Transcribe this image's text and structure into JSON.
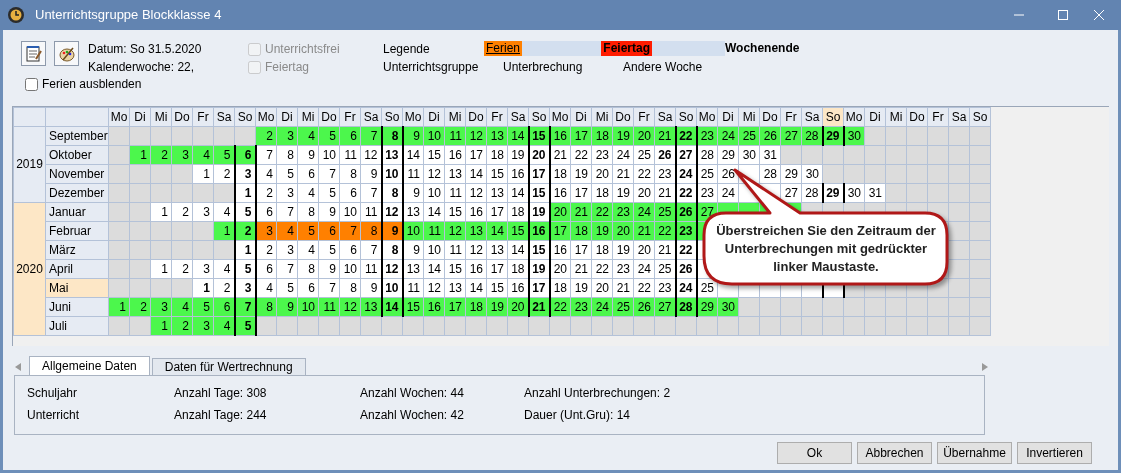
{
  "window": {
    "title": "Unterrichtsgruppe Blockklasse 4"
  },
  "toolbar": {
    "date": "Datum: So 31.5.2020",
    "calendar_week": "Kalenderwoche: 22,",
    "checkboxes": [
      {
        "label": "Unterrichtsfrei",
        "checked": false,
        "disabled": true
      },
      {
        "label": "Feiertag",
        "checked": false,
        "disabled": true
      }
    ],
    "legend": {
      "title": "Legende",
      "items": [
        {
          "label": "Ferien",
          "kind": "ferien"
        },
        {
          "label": "Feiertag",
          "kind": "feiertag"
        },
        {
          "label": "Wochenende",
          "kind": "weekend"
        },
        {
          "label": "Unterrichtsgruppe",
          "kind": "plain"
        },
        {
          "label": "Unterbrechung",
          "kind": "plain"
        },
        {
          "label": "Andere Woche",
          "kind": "plain"
        }
      ]
    },
    "hide_holidays": {
      "label": "Ferien ausblenden",
      "checked": false
    }
  },
  "calendar": {
    "weekdays": [
      {
        "label": "Mo",
        "selected": false
      },
      {
        "label": "Di",
        "selected": false
      },
      {
        "label": "Mi",
        "selected": false
      },
      {
        "label": "Do",
        "selected": false
      },
      {
        "label": "Fr",
        "selected": false
      },
      {
        "label": "Sa",
        "selected": false
      },
      {
        "label": "So",
        "selected": false
      },
      {
        "label": "Mo",
        "selected": false
      },
      {
        "label": "Di",
        "selected": false
      },
      {
        "label": "Mi",
        "selected": false
      },
      {
        "label": "Do",
        "selected": false
      },
      {
        "label": "Fr",
        "selected": false
      },
      {
        "label": "Sa",
        "selected": false
      },
      {
        "label": "So",
        "selected": false
      },
      {
        "label": "Mo",
        "selected": false
      },
      {
        "label": "Di",
        "selected": false
      },
      {
        "label": "Mi",
        "selected": false
      },
      {
        "label": "Do",
        "selected": false
      },
      {
        "label": "Fr",
        "selected": false
      },
      {
        "label": "Sa",
        "selected": false
      },
      {
        "label": "So",
        "selected": false
      },
      {
        "label": "Mo",
        "selected": false
      },
      {
        "label": "Di",
        "selected": false
      },
      {
        "label": "Mi",
        "selected": false
      },
      {
        "label": "Do",
        "selected": false
      },
      {
        "label": "Fr",
        "selected": false
      },
      {
        "label": "Sa",
        "selected": false
      },
      {
        "label": "So",
        "selected": false
      },
      {
        "label": "Mo",
        "selected": false
      },
      {
        "label": "Di",
        "selected": false
      },
      {
        "label": "Mi",
        "selected": false
      },
      {
        "label": "Do",
        "selected": false
      },
      {
        "label": "Fr",
        "selected": false
      },
      {
        "label": "Sa",
        "selected": false
      },
      {
        "label": "So",
        "selected": true
      },
      {
        "label": "Mo",
        "selected": false
      },
      {
        "label": "Di",
        "selected": false
      },
      {
        "label": "Mi",
        "selected": false
      },
      {
        "label": "Do",
        "selected": false
      },
      {
        "label": "Fr",
        "selected": false
      },
      {
        "label": "Sa",
        "selected": false
      },
      {
        "label": "So",
        "selected": false
      }
    ],
    "years": [
      {
        "year": "2019",
        "selected": false,
        "months": [
          {
            "name": "September",
            "selected": false,
            "days": [
              {
                "kind": "blank"
              },
              {
                "kind": "blank"
              },
              {
                "kind": "blank"
              },
              {
                "kind": "blank"
              },
              {
                "kind": "blank"
              },
              {
                "kind": "blank"
              },
              {
                "kind": "blank"
              },
              {
                "day": "2",
                "kind": "lesson"
              },
              {
                "day": "3",
                "kind": "lesson"
              },
              {
                "day": "4",
                "kind": "lesson"
              },
              {
                "day": "5",
                "kind": "lesson"
              },
              {
                "day": "6",
                "kind": "lesson"
              },
              {
                "day": "7",
                "kind": "lesson"
              },
              {
                "day": "8",
                "kind": "lesson"
              },
              {
                "day": "9",
                "kind": "lesson"
              },
              {
                "day": "10",
                "kind": "lesson"
              },
              {
                "day": "11",
                "kind": "lesson"
              },
              {
                "day": "12",
                "kind": "lesson"
              },
              {
                "day": "13",
                "kind": "lesson"
              },
              {
                "day": "14",
                "kind": "lesson"
              },
              {
                "day": "15",
                "kind": "lesson"
              },
              {
                "day": "16",
                "kind": "lesson"
              },
              {
                "day": "17",
                "kind": "lesson"
              },
              {
                "day": "18",
                "kind": "lesson"
              },
              {
                "day": "19",
                "kind": "lesson"
              },
              {
                "day": "20",
                "kind": "lesson"
              },
              {
                "day": "21",
                "kind": "lesson"
              },
              {
                "day": "22",
                "kind": "lesson"
              },
              {
                "day": "23",
                "kind": "lesson"
              },
              {
                "day": "24",
                "kind": "lesson"
              },
              {
                "day": "25",
                "kind": "lesson"
              },
              {
                "day": "26",
                "kind": "lesson"
              },
              {
                "day": "27",
                "kind": "lesson"
              },
              {
                "day": "28",
                "kind": "lesson"
              },
              {
                "day": "29",
                "kind": "lesson"
              },
              {
                "day": "30",
                "kind": "lesson"
              }
            ]
          },
          {
            "name": "Oktober",
            "selected": false,
            "days": [
              {
                "kind": "blank"
              },
              {
                "day": "1",
                "kind": "lesson"
              },
              {
                "day": "2",
                "kind": "lesson"
              },
              {
                "day": "3",
                "kind": "lesson"
              },
              {
                "day": "4",
                "kind": "lesson"
              },
              {
                "day": "5",
                "kind": "lesson"
              },
              {
                "day": "6",
                "kind": "lesson"
              },
              {
                "day": "7",
                "kind": "other"
              },
              {
                "day": "8",
                "kind": "other"
              },
              {
                "day": "9",
                "kind": "other"
              },
              {
                "day": "10",
                "kind": "other"
              },
              {
                "day": "11",
                "kind": "other"
              },
              {
                "day": "12",
                "kind": "other"
              },
              {
                "day": "13",
                "kind": "other"
              },
              {
                "day": "14",
                "kind": "other"
              },
              {
                "day": "15",
                "kind": "other"
              },
              {
                "day": "16",
                "kind": "other"
              },
              {
                "day": "17",
                "kind": "other"
              },
              {
                "day": "18",
                "kind": "other"
              },
              {
                "day": "19",
                "kind": "other"
              },
              {
                "day": "20",
                "kind": "other"
              },
              {
                "day": "21",
                "kind": "other"
              },
              {
                "day": "22",
                "kind": "other"
              },
              {
                "day": "23",
                "kind": "other"
              },
              {
                "day": "24",
                "kind": "other"
              },
              {
                "day": "25",
                "kind": "other"
              },
              {
                "day": "26",
                "kind": "other",
                "bold": true
              },
              {
                "day": "27",
                "kind": "other"
              },
              {
                "day": "28",
                "kind": "other"
              },
              {
                "day": "29",
                "kind": "other"
              },
              {
                "day": "30",
                "kind": "other"
              },
              {
                "day": "31",
                "kind": "other"
              }
            ]
          },
          {
            "name": "November",
            "selected": false,
            "days": [
              {
                "kind": "blank"
              },
              {
                "kind": "blank"
              },
              {
                "kind": "blank"
              },
              {
                "kind": "blank"
              },
              {
                "day": "1",
                "kind": "other"
              },
              {
                "day": "2",
                "kind": "other"
              },
              {
                "day": "3",
                "kind": "other"
              },
              {
                "day": "4",
                "kind": "other"
              },
              {
                "day": "5",
                "kind": "other"
              },
              {
                "day": "6",
                "kind": "other"
              },
              {
                "day": "7",
                "kind": "other"
              },
              {
                "day": "8",
                "kind": "other"
              },
              {
                "day": "9",
                "kind": "other"
              },
              {
                "day": "10",
                "kind": "other"
              },
              {
                "day": "11",
                "kind": "other"
              },
              {
                "day": "12",
                "kind": "other"
              },
              {
                "day": "13",
                "kind": "other"
              },
              {
                "day": "14",
                "kind": "other"
              },
              {
                "day": "15",
                "kind": "other"
              },
              {
                "day": "16",
                "kind": "other"
              },
              {
                "day": "17",
                "kind": "other"
              },
              {
                "day": "18",
                "kind": "other"
              },
              {
                "day": "19",
                "kind": "other"
              },
              {
                "day": "20",
                "kind": "other"
              },
              {
                "day": "21",
                "kind": "other"
              },
              {
                "day": "22",
                "kind": "other"
              },
              {
                "day": "23",
                "kind": "other"
              },
              {
                "day": "24",
                "kind": "other"
              },
              {
                "day": "25",
                "kind": "other"
              },
              {
                "day": "26",
                "kind": "other"
              },
              {
                "kind": "other"
              },
              {
                "day": "28",
                "kind": "other"
              },
              {
                "day": "29",
                "kind": "other"
              },
              {
                "day": "30",
                "kind": "other"
              }
            ]
          },
          {
            "name": "Dezember",
            "selected": false,
            "days": [
              {
                "kind": "blank"
              },
              {
                "kind": "blank"
              },
              {
                "kind": "blank"
              },
              {
                "kind": "blank"
              },
              {
                "kind": "blank"
              },
              {
                "kind": "blank"
              },
              {
                "day": "1",
                "kind": "other"
              },
              {
                "day": "2",
                "kind": "other"
              },
              {
                "day": "3",
                "kind": "other"
              },
              {
                "day": "4",
                "kind": "other"
              },
              {
                "day": "5",
                "kind": "other"
              },
              {
                "day": "6",
                "kind": "other"
              },
              {
                "day": "7",
                "kind": "other"
              },
              {
                "day": "8",
                "kind": "other"
              },
              {
                "day": "9",
                "kind": "other"
              },
              {
                "day": "10",
                "kind": "other"
              },
              {
                "day": "11",
                "kind": "other"
              },
              {
                "day": "12",
                "kind": "other"
              },
              {
                "day": "13",
                "kind": "other"
              },
              {
                "day": "14",
                "kind": "other"
              },
              {
                "day": "15",
                "kind": "other"
              },
              {
                "day": "16",
                "kind": "other"
              },
              {
                "day": "17",
                "kind": "other"
              },
              {
                "day": "18",
                "kind": "other"
              },
              {
                "day": "19",
                "kind": "other"
              },
              {
                "day": "20",
                "kind": "other"
              },
              {
                "day": "21",
                "kind": "other"
              },
              {
                "day": "22",
                "kind": "other"
              },
              {
                "day": "23",
                "kind": "other"
              },
              {
                "day": "24",
                "kind": "other"
              },
              {
                "kind": "other"
              },
              {
                "kind": "other"
              },
              {
                "day": "27",
                "kind": "other"
              },
              {
                "day": "28",
                "kind": "other"
              },
              {
                "day": "29",
                "kind": "other"
              },
              {
                "day": "30",
                "kind": "other"
              },
              {
                "day": "31",
                "kind": "other"
              }
            ]
          }
        ]
      },
      {
        "year": "2020",
        "selected": true,
        "months": [
          {
            "name": "Januar",
            "selected": false,
            "days": [
              {
                "kind": "blank"
              },
              {
                "kind": "blank"
              },
              {
                "day": "1",
                "kind": "other"
              },
              {
                "day": "2",
                "kind": "other"
              },
              {
                "day": "3",
                "kind": "other"
              },
              {
                "day": "4",
                "kind": "other"
              },
              {
                "day": "5",
                "kind": "other"
              },
              {
                "day": "6",
                "kind": "other"
              },
              {
                "day": "7",
                "kind": "other"
              },
              {
                "day": "8",
                "kind": "other"
              },
              {
                "day": "9",
                "kind": "other"
              },
              {
                "day": "10",
                "kind": "other"
              },
              {
                "day": "11",
                "kind": "other"
              },
              {
                "day": "12",
                "kind": "other"
              },
              {
                "day": "13",
                "kind": "other"
              },
              {
                "day": "14",
                "kind": "other"
              },
              {
                "day": "15",
                "kind": "other"
              },
              {
                "day": "16",
                "kind": "other"
              },
              {
                "day": "17",
                "kind": "other"
              },
              {
                "day": "18",
                "kind": "other"
              },
              {
                "day": "19",
                "kind": "other"
              },
              {
                "day": "20",
                "kind": "lesson"
              },
              {
                "day": "21",
                "kind": "lesson"
              },
              {
                "day": "22",
                "kind": "lesson"
              },
              {
                "day": "23",
                "kind": "lesson"
              },
              {
                "day": "24",
                "kind": "lesson"
              },
              {
                "day": "25",
                "kind": "lesson"
              },
              {
                "day": "26",
                "kind": "lesson"
              },
              {
                "day": "27",
                "kind": "lesson"
              },
              {
                "kind": "lesson"
              },
              {
                "kind": "lesson"
              },
              {
                "kind": "lesson"
              },
              {
                "kind": "lesson"
              }
            ]
          },
          {
            "name": "Februar",
            "selected": false,
            "days": [
              {
                "kind": "blank"
              },
              {
                "kind": "blank"
              },
              {
                "kind": "blank"
              },
              {
                "kind": "blank"
              },
              {
                "kind": "blank"
              },
              {
                "day": "1",
                "kind": "lesson"
              },
              {
                "day": "2",
                "kind": "lesson"
              },
              {
                "day": "3",
                "kind": "ferien"
              },
              {
                "day": "4",
                "kind": "ferien"
              },
              {
                "day": "5",
                "kind": "ferien"
              },
              {
                "day": "6",
                "kind": "ferien"
              },
              {
                "day": "7",
                "kind": "ferien"
              },
              {
                "day": "8",
                "kind": "ferien"
              },
              {
                "day": "9",
                "kind": "ferien"
              },
              {
                "day": "10",
                "kind": "lesson"
              },
              {
                "day": "11",
                "kind": "lesson"
              },
              {
                "day": "12",
                "kind": "lesson"
              },
              {
                "day": "13",
                "kind": "lesson"
              },
              {
                "day": "14",
                "kind": "lesson"
              },
              {
                "day": "15",
                "kind": "lesson"
              },
              {
                "day": "16",
                "kind": "lesson"
              },
              {
                "day": "17",
                "kind": "lesson"
              },
              {
                "day": "18",
                "kind": "lesson"
              },
              {
                "day": "19",
                "kind": "lesson"
              },
              {
                "day": "20",
                "kind": "lesson"
              },
              {
                "day": "21",
                "kind": "lesson"
              },
              {
                "day": "22",
                "kind": "lesson"
              },
              {
                "day": "23",
                "kind": "lesson"
              },
              {
                "kind": "lesson"
              }
            ]
          },
          {
            "name": "März",
            "selected": false,
            "days": [
              {
                "kind": "blank"
              },
              {
                "kind": "blank"
              },
              {
                "kind": "blank"
              },
              {
                "kind": "blank"
              },
              {
                "kind": "blank"
              },
              {
                "kind": "blank"
              },
              {
                "day": "1",
                "kind": "other"
              },
              {
                "day": "2",
                "kind": "other"
              },
              {
                "day": "3",
                "kind": "other"
              },
              {
                "day": "4",
                "kind": "other"
              },
              {
                "day": "5",
                "kind": "other"
              },
              {
                "day": "6",
                "kind": "other"
              },
              {
                "day": "7",
                "kind": "other"
              },
              {
                "day": "8",
                "kind": "other"
              },
              {
                "day": "9",
                "kind": "other"
              },
              {
                "day": "10",
                "kind": "other"
              },
              {
                "day": "11",
                "kind": "other"
              },
              {
                "day": "12",
                "kind": "other"
              },
              {
                "day": "13",
                "kind": "other"
              },
              {
                "day": "14",
                "kind": "other"
              },
              {
                "day": "15",
                "kind": "other"
              },
              {
                "day": "16",
                "kind": "other"
              },
              {
                "day": "17",
                "kind": "other"
              },
              {
                "day": "18",
                "kind": "other"
              },
              {
                "day": "19",
                "kind": "other"
              },
              {
                "day": "20",
                "kind": "other"
              },
              {
                "day": "21",
                "kind": "other"
              },
              {
                "day": "22",
                "kind": "other"
              },
              {
                "kind": "other"
              }
            ]
          },
          {
            "name": "April",
            "selected": false,
            "days": [
              {
                "kind": "blank"
              },
              {
                "kind": "blank"
              },
              {
                "day": "1",
                "kind": "other"
              },
              {
                "day": "2",
                "kind": "other"
              },
              {
                "day": "3",
                "kind": "other"
              },
              {
                "day": "4",
                "kind": "other"
              },
              {
                "day": "5",
                "kind": "other"
              },
              {
                "day": "6",
                "kind": "other"
              },
              {
                "day": "7",
                "kind": "other"
              },
              {
                "day": "8",
                "kind": "other"
              },
              {
                "day": "9",
                "kind": "other"
              },
              {
                "day": "10",
                "kind": "other"
              },
              {
                "day": "11",
                "kind": "other"
              },
              {
                "day": "12",
                "kind": "other"
              },
              {
                "day": "13",
                "kind": "other"
              },
              {
                "day": "14",
                "kind": "other"
              },
              {
                "day": "15",
                "kind": "other"
              },
              {
                "day": "16",
                "kind": "other"
              },
              {
                "day": "17",
                "kind": "other"
              },
              {
                "day": "18",
                "kind": "other"
              },
              {
                "day": "19",
                "kind": "other"
              },
              {
                "day": "20",
                "kind": "other"
              },
              {
                "day": "21",
                "kind": "other"
              },
              {
                "day": "22",
                "kind": "other"
              },
              {
                "day": "23",
                "kind": "other"
              },
              {
                "day": "24",
                "kind": "other"
              },
              {
                "day": "25",
                "kind": "other"
              },
              {
                "day": "26",
                "kind": "other"
              },
              {
                "kind": "other"
              }
            ]
          },
          {
            "name": "Mai",
            "selected": true,
            "days": [
              {
                "kind": "blank"
              },
              {
                "kind": "blank"
              },
              {
                "kind": "blank"
              },
              {
                "kind": "blank"
              },
              {
                "day": "1",
                "kind": "other",
                "bold": true
              },
              {
                "day": "2",
                "kind": "other"
              },
              {
                "day": "3",
                "kind": "other"
              },
              {
                "day": "4",
                "kind": "other"
              },
              {
                "day": "5",
                "kind": "other"
              },
              {
                "day": "6",
                "kind": "other"
              },
              {
                "day": "7",
                "kind": "other"
              },
              {
                "day": "8",
                "kind": "other"
              },
              {
                "day": "9",
                "kind": "other"
              },
              {
                "day": "10",
                "kind": "other"
              },
              {
                "day": "11",
                "kind": "other"
              },
              {
                "day": "12",
                "kind": "other"
              },
              {
                "day": "13",
                "kind": "other"
              },
              {
                "day": "14",
                "kind": "other"
              },
              {
                "day": "15",
                "kind": "other"
              },
              {
                "day": "16",
                "kind": "other"
              },
              {
                "day": "17",
                "kind": "other"
              },
              {
                "day": "18",
                "kind": "other"
              },
              {
                "day": "19",
                "kind": "other"
              },
              {
                "day": "20",
                "kind": "other"
              },
              {
                "day": "21",
                "kind": "other"
              },
              {
                "day": "22",
                "kind": "other"
              },
              {
                "day": "23",
                "kind": "other"
              },
              {
                "day": "24",
                "kind": "other"
              },
              {
                "day": "25",
                "kind": "other"
              },
              {
                "kind": "other"
              },
              {
                "kind": "other"
              },
              {
                "kind": "other"
              },
              {
                "kind": "other"
              },
              {
                "kind": "other"
              },
              {
                "kind": "other"
              }
            ]
          },
          {
            "name": "Juni",
            "selected": false,
            "days": [
              {
                "day": "1",
                "kind": "lesson"
              },
              {
                "day": "2",
                "kind": "lesson"
              },
              {
                "day": "3",
                "kind": "lesson"
              },
              {
                "day": "4",
                "kind": "lesson"
              },
              {
                "day": "5",
                "kind": "lesson"
              },
              {
                "day": "6",
                "kind": "lesson"
              },
              {
                "day": "7",
                "kind": "lesson"
              },
              {
                "day": "8",
                "kind": "lesson"
              },
              {
                "day": "9",
                "kind": "lesson"
              },
              {
                "day": "10",
                "kind": "lesson"
              },
              {
                "day": "11",
                "kind": "lesson"
              },
              {
                "day": "12",
                "kind": "lesson"
              },
              {
                "day": "13",
                "kind": "lesson"
              },
              {
                "day": "14",
                "kind": "lesson"
              },
              {
                "day": "15",
                "kind": "lesson"
              },
              {
                "day": "16",
                "kind": "lesson"
              },
              {
                "day": "17",
                "kind": "lesson"
              },
              {
                "day": "18",
                "kind": "lesson"
              },
              {
                "day": "19",
                "kind": "lesson"
              },
              {
                "day": "20",
                "kind": "lesson"
              },
              {
                "day": "21",
                "kind": "lesson"
              },
              {
                "day": "22",
                "kind": "lesson"
              },
              {
                "day": "23",
                "kind": "lesson"
              },
              {
                "day": "24",
                "kind": "lesson"
              },
              {
                "day": "25",
                "kind": "lesson"
              },
              {
                "day": "26",
                "kind": "lesson"
              },
              {
                "day": "27",
                "kind": "lesson"
              },
              {
                "day": "28",
                "kind": "lesson"
              },
              {
                "day": "29",
                "kind": "lesson"
              },
              {
                "day": "30",
                "kind": "lesson"
              }
            ]
          },
          {
            "name": "Juli",
            "selected": false,
            "days": [
              {
                "kind": "blank"
              },
              {
                "kind": "blank"
              },
              {
                "day": "1",
                "kind": "lesson"
              },
              {
                "day": "2",
                "kind": "lesson"
              },
              {
                "day": "3",
                "kind": "lesson"
              },
              {
                "day": "4",
                "kind": "lesson"
              },
              {
                "day": "5",
                "kind": "lesson"
              }
            ]
          }
        ]
      }
    ]
  },
  "callout": {
    "text": "Überstreichen Sie den Zeitraum der Unterbrechungen mit gedrückter linker Maustaste."
  },
  "tabs": [
    {
      "label": "Allgemeine Daten",
      "selected": true
    },
    {
      "label": "Daten für Wertrechnung",
      "selected": false
    }
  ],
  "stats": [
    {
      "label": "Schuljahr",
      "values": [
        "Anzahl Tage: 308",
        "Anzahl Wochen: 44",
        "Anzahl Unterbrechungen: 2"
      ]
    },
    {
      "label": "Unterricht",
      "values": [
        "Anzahl Tage: 244",
        "Anzahl Wochen: 42",
        "Dauer (Unt.Gru): 14"
      ]
    }
  ],
  "buttons": [
    "Ok",
    "Abbrechen",
    "Übernahme",
    "Invertieren"
  ]
}
